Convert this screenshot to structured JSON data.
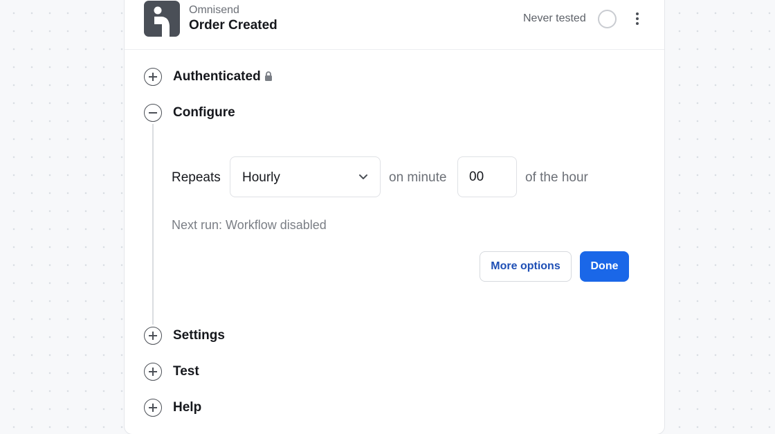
{
  "header": {
    "app_name": "Omnisend",
    "trigger_name": "Order Created",
    "test_status": "Never tested",
    "logo_icon": "omnisend-logo-icon",
    "status_icon": "status-circle-icon",
    "menu_icon": "more-vertical-icon"
  },
  "sections": {
    "authenticated": {
      "label": "Authenticated",
      "state": "collapsed",
      "icon": "lock-icon"
    },
    "configure": {
      "label": "Configure",
      "state": "expanded"
    },
    "settings": {
      "label": "Settings",
      "state": "collapsed"
    },
    "test": {
      "label": "Test",
      "state": "collapsed"
    },
    "help": {
      "label": "Help",
      "state": "collapsed"
    }
  },
  "configure": {
    "repeats_label": "Repeats",
    "frequency_value": "Hourly",
    "on_minute_label": "on minute",
    "minute_value": "00",
    "of_hour_label": "of the hour",
    "next_run": "Next run: Workflow disabled",
    "more_options_label": "More options",
    "done_label": "Done"
  },
  "colors": {
    "primary": "#1a67e8",
    "link": "#1e4fb5",
    "logo_bg": "#4a4f57"
  }
}
